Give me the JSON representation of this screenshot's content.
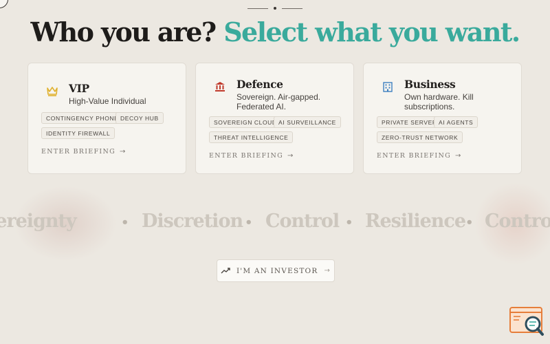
{
  "headline": {
    "part1": "Who you are?",
    "part2": "Select what you want."
  },
  "cards": [
    {
      "icon": "crown-icon",
      "icon_glyph": "♛",
      "icon_color": "#e0b12e",
      "title": "VIP",
      "subtitle": "High-Value Individual",
      "tags": [
        "CONTINGENCY PHONE",
        "DECOY HUB",
        "IDENTITY FIREWALL"
      ],
      "cta": "ENTER BRIEFING"
    },
    {
      "icon": "bank-icon",
      "icon_glyph": "🏛",
      "icon_color": "#c0392b",
      "title": "Defence",
      "subtitle": "Sovereign. Air-gapped. Federated AI.",
      "tags": [
        "SOVEREIGN CLOUD",
        "AI SURVEILLANCE",
        "THREAT INTELLIGENCE"
      ],
      "cta": "ENTER BRIEFING"
    },
    {
      "icon": "office-building-icon",
      "icon_glyph": "▦",
      "icon_color": "#3d7fc1",
      "title": "Business",
      "subtitle": "Own hardware. Kill subscriptions.",
      "tags": [
        "PRIVATE SERVER",
        "AI AGENTS",
        "ZERO-TRUST NETWORK"
      ],
      "cta": "ENTER BRIEFING"
    }
  ],
  "marquee": [
    "Sovereignty",
    "Discretion",
    "Control",
    "Resilience",
    "Control"
  ],
  "investor_button": {
    "label": "I'M AN INVESTOR",
    "icon": "trending-up-icon"
  },
  "colors": {
    "accent": "#3aaa9c",
    "background": "#ece8e1",
    "card": "#f6f4ef"
  }
}
